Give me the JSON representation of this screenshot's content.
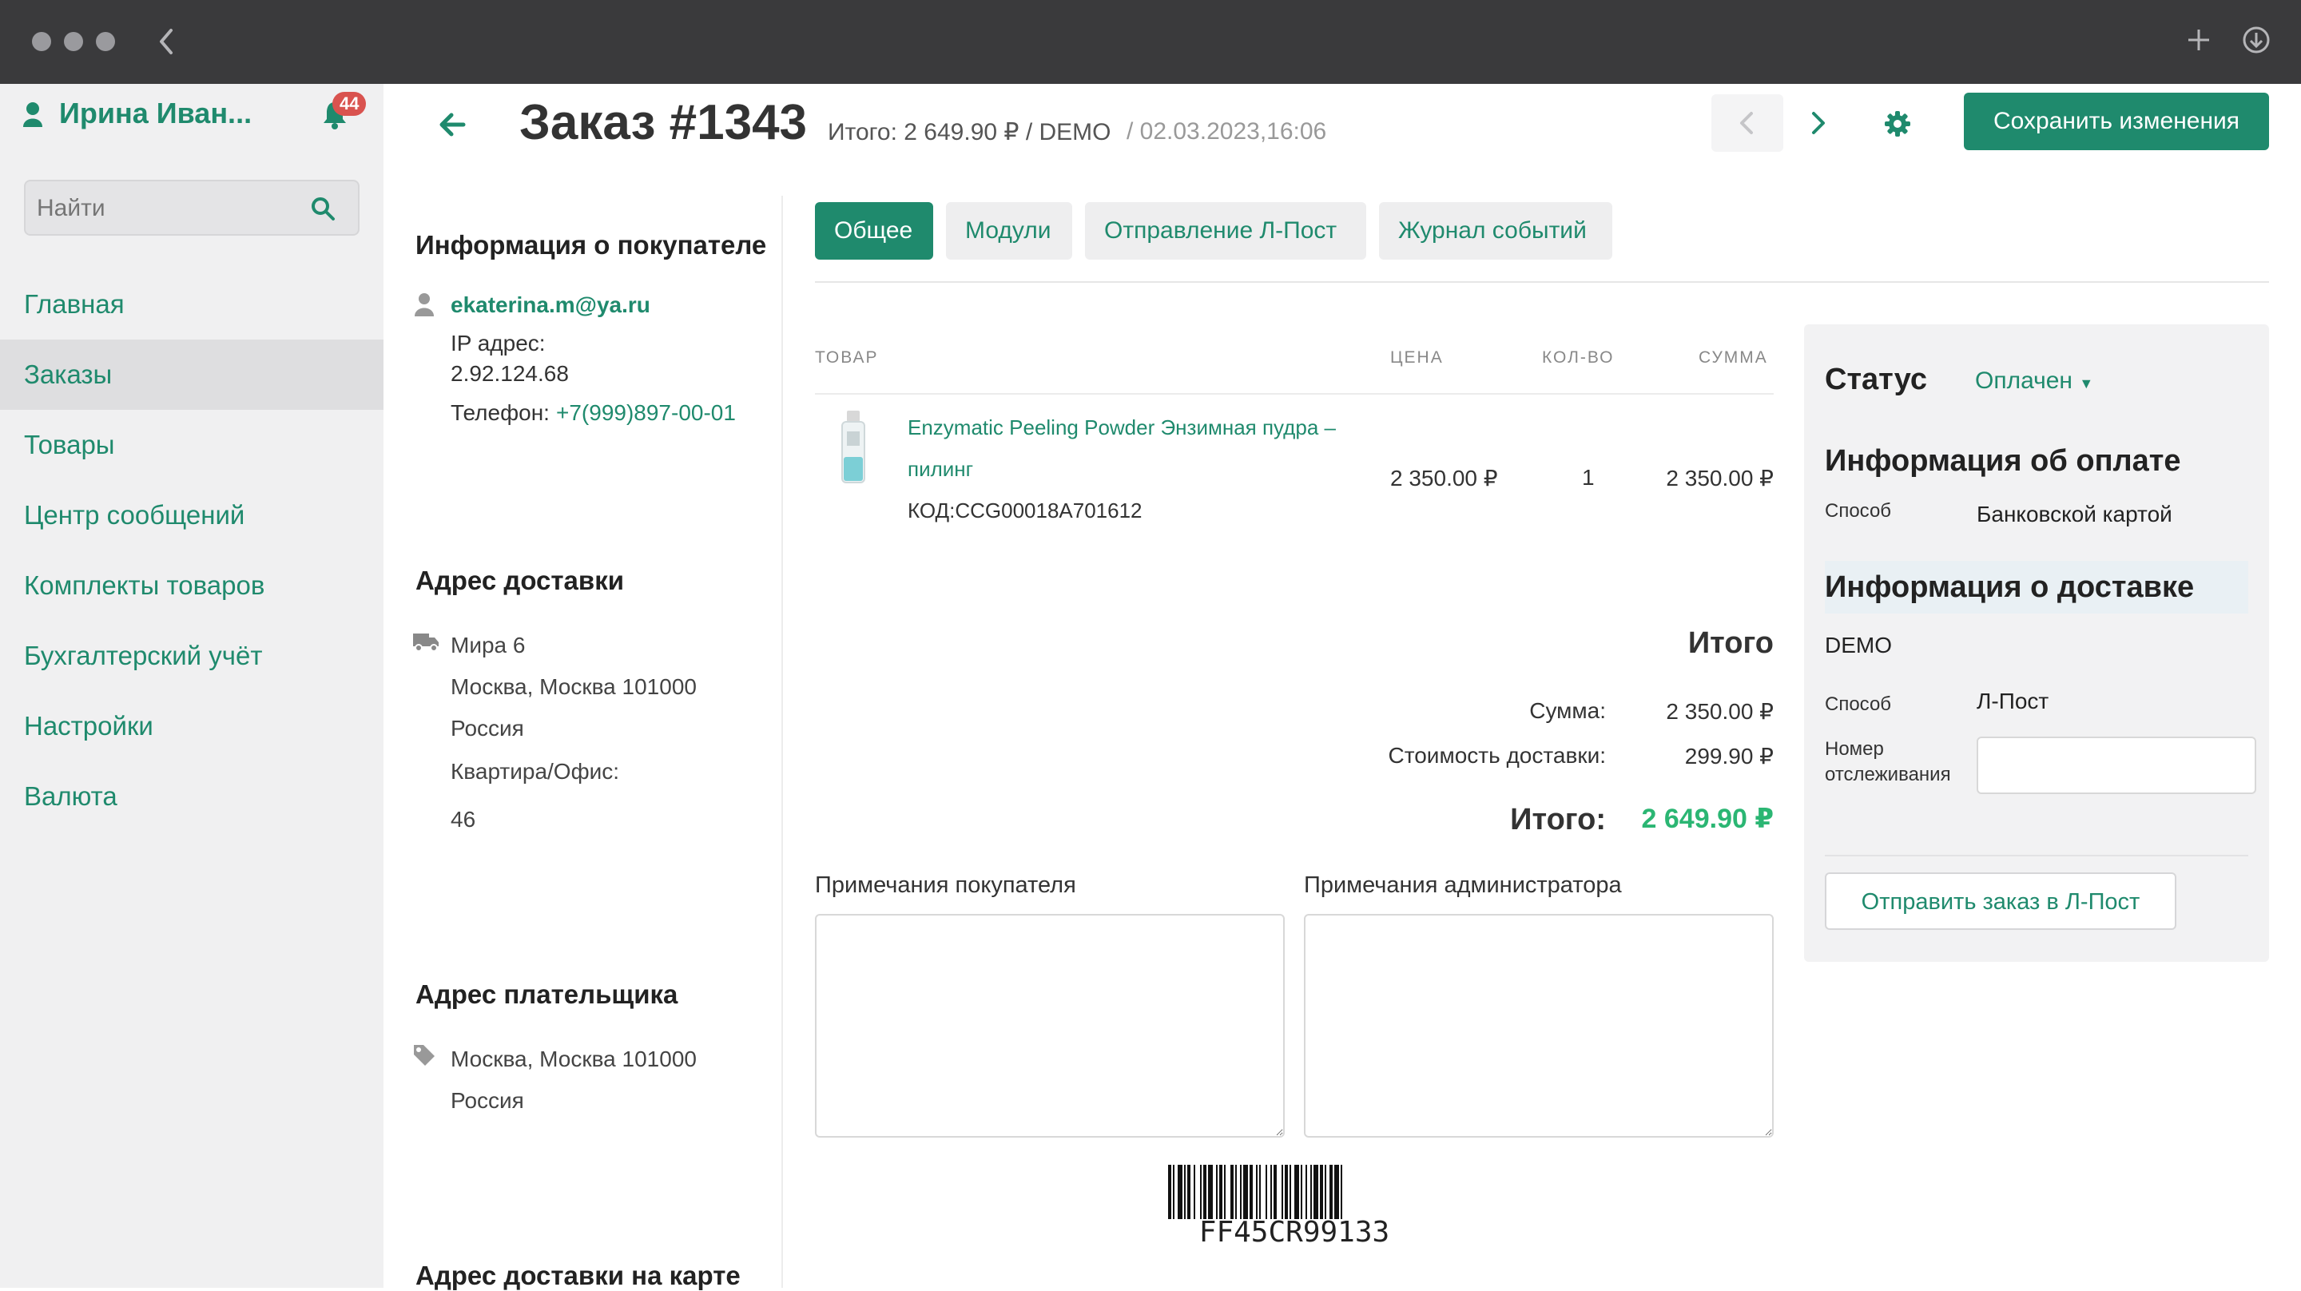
{
  "sidebar": {
    "user_name": "Ирина Иван...",
    "notifications_count": "44",
    "search_placeholder": "Найти",
    "nav": [
      "Главная",
      "Заказы",
      "Товары",
      "Центр сообщений",
      "Комплекты товаров",
      "Бухгалтерский учёт",
      "Настройки",
      "Валюта"
    ]
  },
  "header": {
    "title": "Заказ #1343",
    "summary": "Итого: 2 649.90 ₽ / DEMO",
    "date": "/ 02.03.2023,16:06",
    "save_label": "Сохранить изменения"
  },
  "customer": {
    "heading": "Информация о покупателе",
    "email": "ekaterina.m@ya.ru",
    "ip_label": "IP адрес:",
    "ip_value": "2.92.124.68",
    "phone_label": "Телефон:",
    "phone_value": "+7(999)897-00-01"
  },
  "delivery_address": {
    "heading": "Адрес доставки",
    "street": "Мира 6",
    "city": "Москва, Москва 101000",
    "country": "Россия",
    "apt_label": "Квартира/Офис:",
    "apt_value": "46"
  },
  "payer_address": {
    "heading": "Адрес плательщика",
    "city": "Москва, Москва 101000",
    "country": "Россия"
  },
  "map_heading": "Адрес доставки на карте",
  "tabs": [
    "Общее",
    "Модули",
    "Отправление Л-Пост",
    "Журнал событий"
  ],
  "table": {
    "headers": {
      "product": "ТОВАР",
      "price": "ЦЕНА",
      "qty": "КОЛ-ВО",
      "sum": "СУММА"
    },
    "row": {
      "name_line1": "Enzymatic Peeling Powder Энзимная пудра –",
      "name_line2": "пилинг",
      "code": "КОД:CCG00018A701612",
      "price": "2 350.00 ₽",
      "qty": "1",
      "sum": "2 350.00 ₽"
    }
  },
  "totals": {
    "heading": "Итого",
    "sum_label": "Сумма:",
    "sum_value": "2 350.00 ₽",
    "shipping_label": "Стоимость доставки:",
    "shipping_value": "299.90 ₽",
    "total_label": "Итого:",
    "total_value": "2 649.90 ₽"
  },
  "notes": {
    "customer_label": "Примечания покупателя",
    "admin_label": "Примечания администратора"
  },
  "barcode_text": "FF45CR99133",
  "right_panel": {
    "status_label": "Статус",
    "status_value": "Оплачен",
    "payment_heading": "Информация об оплате",
    "payment_method_label": "Способ",
    "payment_method_value": "Банковской картой",
    "delivery_heading": "Информация о доставке",
    "delivery_name": "DEMO",
    "delivery_method_label": "Способ",
    "delivery_method_value": "Л-Пост",
    "tracking_label_1": "Номер",
    "tracking_label_2": "отслеживания",
    "send_button": "Отправить заказ в Л-Пост"
  },
  "colors": {
    "accent": "#1f8a6d",
    "total": "#2bb673",
    "badge": "#d9534f"
  }
}
